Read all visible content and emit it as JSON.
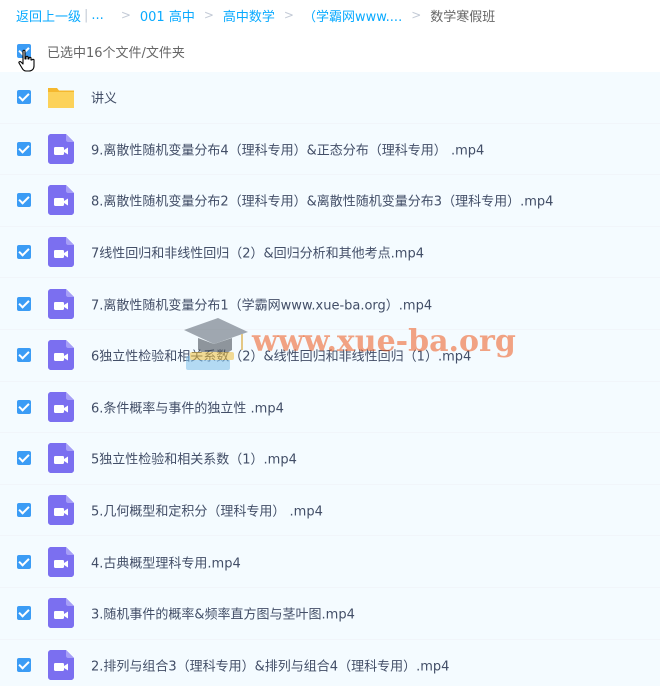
{
  "breadcrumb": {
    "back_label": "返回上一级",
    "ellipsis": "...",
    "items": [
      "001 高中",
      "高中数学",
      "（学霸网www...."
    ],
    "current": "数学寒假班"
  },
  "selection": {
    "text": "已选中16个文件/文件夹"
  },
  "watermark": {
    "text": "www.xue-ba.org"
  },
  "colors": {
    "accent": "#09aaff",
    "checkbox": "#3b9cf5",
    "folder": "#f9c94b",
    "video_icon": "#7b6ff0",
    "row_bg": "#f4fbff"
  },
  "files": [
    {
      "type": "folder",
      "icon": "folder-icon",
      "name": "讲义"
    },
    {
      "type": "video",
      "icon": "video-file-icon",
      "name": "9.离散性随机变量分布4（理科专用）&正态分布（理科专用） .mp4"
    },
    {
      "type": "video",
      "icon": "video-file-icon",
      "name": "8.离散性随机变量分布2（理科专用）&离散性随机变量分布3（理科专用）.mp4"
    },
    {
      "type": "video",
      "icon": "video-file-icon",
      "name": "7线性回归和非线性回归（2）&回归分析和其他考点.mp4"
    },
    {
      "type": "video",
      "icon": "video-file-icon",
      "name": "7.离散性随机变量分布1（学霸网www.xue-ba.org）.mp4"
    },
    {
      "type": "video",
      "icon": "video-file-icon",
      "name": "6独立性检验和相关系数（2）&线性回归和非线性回归（1）.mp4"
    },
    {
      "type": "video",
      "icon": "video-file-icon",
      "name": "6.条件概率与事件的独立性 .mp4"
    },
    {
      "type": "video",
      "icon": "video-file-icon",
      "name": "5独立性检验和相关系数（1）.mp4"
    },
    {
      "type": "video",
      "icon": "video-file-icon",
      "name": "5.几何概型和定积分（理科专用） .mp4"
    },
    {
      "type": "video",
      "icon": "video-file-icon",
      "name": "4.古典概型理科专用.mp4"
    },
    {
      "type": "video",
      "icon": "video-file-icon",
      "name": "3.随机事件的概率&频率直方图与茎叶图.mp4"
    },
    {
      "type": "video",
      "icon": "video-file-icon",
      "name": "2.排列与组合3（理科专用）&排列与组合4（理科专用）.mp4"
    }
  ]
}
